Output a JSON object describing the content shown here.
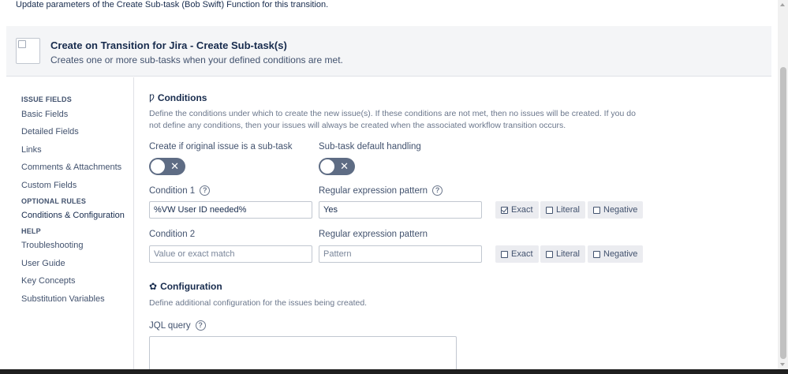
{
  "intro_text": "Update parameters of the Create Sub-task (Bob Swift) Function for this transition.",
  "header": {
    "title": "Create on Transition for Jira - Create Sub-task(s)",
    "subtitle": "Creates one or more sub-tasks when your defined conditions are met."
  },
  "sidebar": {
    "sections": [
      {
        "heading": "ISSUE FIELDS",
        "items": [
          "Basic Fields",
          "Detailed Fields",
          "Links",
          "Comments & Attachments",
          "Custom Fields"
        ]
      },
      {
        "heading": "OPTIONAL RULES",
        "items": [
          "Conditions & Configuration"
        ]
      },
      {
        "heading": "HELP",
        "items": [
          "Troubleshooting",
          "User Guide",
          "Key Concepts",
          "Substitution Variables"
        ]
      }
    ],
    "active_item": "Conditions & Configuration"
  },
  "conditions": {
    "title": "Conditions",
    "icon": "filter-icon",
    "description": "Define the conditions under which to create the new issue(s). If these conditions are not met, then no issues will be created. If you do not define any conditions, then your issues will always be created when the associated workflow transition occurs.",
    "toggle1_label": "Create if original issue is a sub-task",
    "toggle2_label": "Sub-task default handling",
    "rows": [
      {
        "label": "Condition 1",
        "has_help": true,
        "value": "%VW User ID needed%",
        "value_placeholder": "Value or exact match",
        "pattern_label": "Regular expression pattern",
        "pattern_has_help": true,
        "pattern": "Yes",
        "pattern_placeholder": "Pattern",
        "options": [
          {
            "label": "Exact",
            "checked": true
          },
          {
            "label": "Literal",
            "checked": false
          },
          {
            "label": "Negative",
            "checked": false
          }
        ]
      },
      {
        "label": "Condition 2",
        "has_help": false,
        "value": "",
        "value_placeholder": "Value or exact match",
        "pattern_label": "Regular expression pattern",
        "pattern_has_help": false,
        "pattern": "",
        "pattern_placeholder": "Pattern",
        "options": [
          {
            "label": "Exact",
            "checked": false
          },
          {
            "label": "Literal",
            "checked": false
          },
          {
            "label": "Negative",
            "checked": false
          }
        ]
      }
    ]
  },
  "configuration": {
    "title": "Configuration",
    "icon": "gear-icon",
    "description": "Define additional configuration for the issues being created.",
    "jql_label": "JQL query"
  }
}
